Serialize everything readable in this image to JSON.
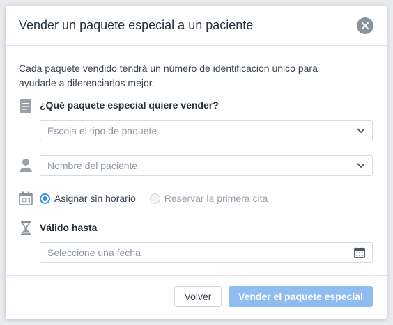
{
  "modal": {
    "title": "Vender un paquete especial a un paciente",
    "description": "Cada paquete vendido tendrá un número de identificación único para ayudarle a diferenciarlos mejor.",
    "package_question": "¿Qué paquete especial quiere vender?",
    "package_placeholder": "Escoja el tipo de paquete",
    "patient_placeholder": "Nombre del paciente",
    "schedule_options": [
      {
        "label": "Asignar sin horario",
        "selected": true
      },
      {
        "label": "Reservar la primera cita",
        "selected": false
      }
    ],
    "valid_until_label": "Válido hasta",
    "date_placeholder": "Seleccione una fecha",
    "back_button": "Volver",
    "sell_button": "Vender el paquete especial"
  },
  "colors": {
    "accent": "#3b8ee6",
    "primary_button_disabled": "#8fbdf0",
    "close_button": "#8a939d"
  },
  "icons": {
    "close": "close-icon",
    "document": "document-icon",
    "person": "person-icon",
    "calendar": "calendar-icon",
    "hourglass": "hourglass-icon",
    "chevron": "chevron-down-icon",
    "date": "calendar-icon"
  }
}
